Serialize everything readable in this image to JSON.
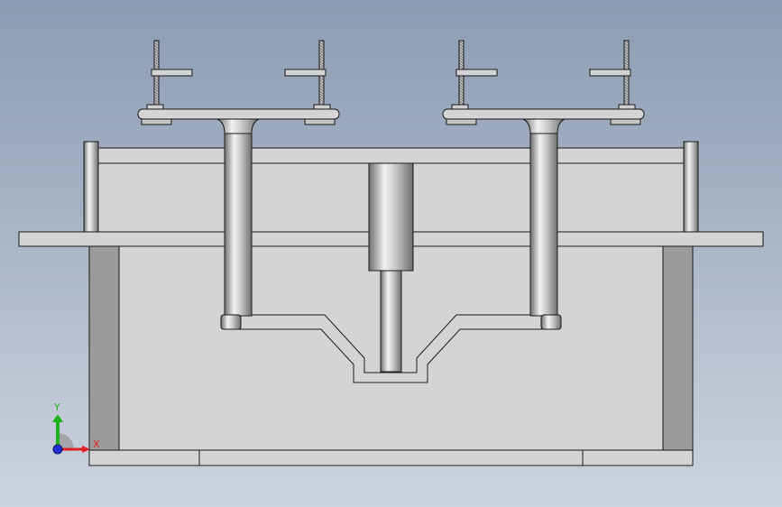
{
  "viewport": {
    "background_top": "#8c9cb2",
    "background_bottom": "#cdd3de"
  },
  "model": {
    "part_fill": "#d4d4d4",
    "part_stroke": "#1a1a1a",
    "shadow_fill": "#9b9b9b",
    "metal_light": "#f2f2f2",
    "metal_dark": "#6e6e6e"
  },
  "triad": {
    "x_label": "X",
    "y_label": "Y",
    "x_color": "#e02020",
    "y_color": "#22b022",
    "z_color": "#2030d0"
  }
}
